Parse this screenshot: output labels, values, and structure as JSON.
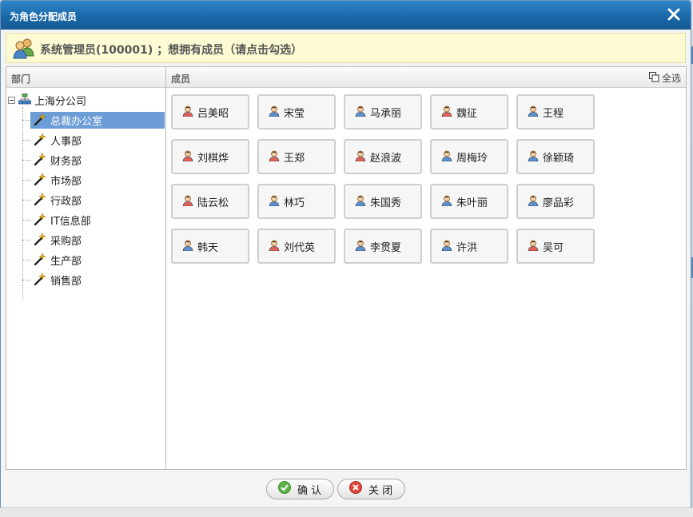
{
  "dialog": {
    "title": "为角色分配成员",
    "info": "系统管理员(100001) ；想拥有成员（请点击勾选）",
    "confirm_label": "确 认",
    "close_label": "关 闭"
  },
  "left_panel": {
    "header": "部门",
    "root": "上海分公司",
    "departments": [
      "总裁办公室",
      "人事部",
      "财务部",
      "市场部",
      "行政部",
      "IT信息部",
      "采购部",
      "生产部",
      "销售部"
    ],
    "selected": "总裁办公室"
  },
  "right_panel": {
    "header": "成员",
    "select_all": "全选",
    "members": [
      {
        "name": "吕美昭",
        "gender": "female"
      },
      {
        "name": "宋莹",
        "gender": "male"
      },
      {
        "name": "马承丽",
        "gender": "male"
      },
      {
        "name": "魏征",
        "gender": "female"
      },
      {
        "name": "王程",
        "gender": "male"
      },
      {
        "name": "刘棋烨",
        "gender": "female"
      },
      {
        "name": "王郑",
        "gender": "female"
      },
      {
        "name": "赵浪波",
        "gender": "female"
      },
      {
        "name": "周梅玲",
        "gender": "male"
      },
      {
        "name": "徐颖琦",
        "gender": "male"
      },
      {
        "name": "陆云松",
        "gender": "female"
      },
      {
        "name": "林巧",
        "gender": "male"
      },
      {
        "name": "朱国秀",
        "gender": "male"
      },
      {
        "name": "朱叶丽",
        "gender": "male"
      },
      {
        "name": "廖品彩",
        "gender": "male"
      },
      {
        "name": "韩天",
        "gender": "male"
      },
      {
        "name": "刘代英",
        "gender": "female"
      },
      {
        "name": "李贯夏",
        "gender": "male"
      },
      {
        "name": "许洪",
        "gender": "male"
      },
      {
        "name": "吴可",
        "gender": "female"
      }
    ]
  },
  "colors": {
    "titlebar": "#1a68a8",
    "selected_node": "#6c9dd6",
    "info_bg": "#fdfbd3",
    "female_icon": "#e0605a",
    "male_icon": "#5b8fd0"
  }
}
